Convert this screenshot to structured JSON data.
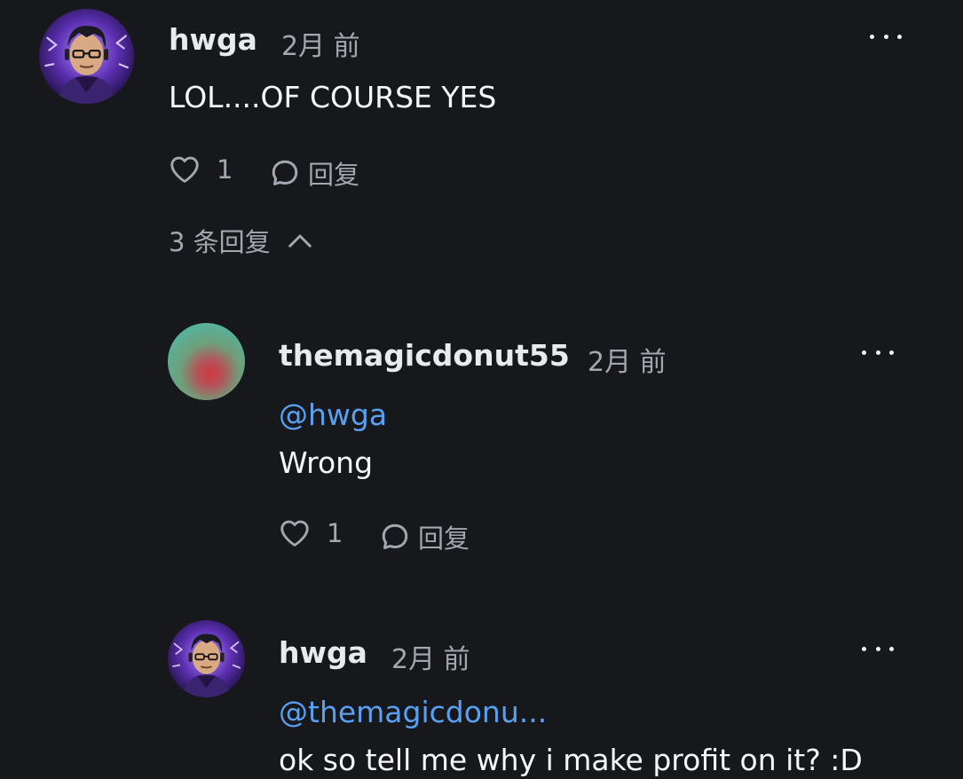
{
  "comments": [
    {
      "username": "hwga",
      "time": "2月 前",
      "mention": "",
      "text": "LOL....OF COURSE YES",
      "likes": "1",
      "reply_label": "回复"
    },
    {
      "username": "themagicdonut55",
      "time": "2月 前",
      "mention": "@hwga",
      "text": "Wrong",
      "likes": "1",
      "reply_label": "回复"
    },
    {
      "username": "hwga",
      "time": "2月 前",
      "mention": "@themagicdonu...",
      "text": "ok so tell me why i make profit on it? :D"
    }
  ],
  "thread_toggle": {
    "label": "3 条回复"
  },
  "colors": {
    "background": "#16181c",
    "mention": "#5aa0f2",
    "muted": "#a3a7b0",
    "text": "#f5f6f8"
  },
  "icons": {
    "more": "more-options-icon",
    "like": "heart-icon",
    "reply": "comment-bubble-icon",
    "collapse": "chevron-up-icon"
  }
}
